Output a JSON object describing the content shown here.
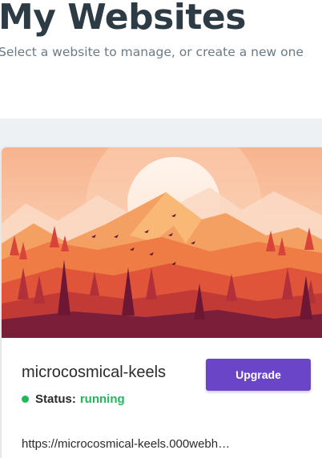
{
  "header": {
    "title": "My Websites",
    "subtitle": "Select a website to manage, or create a new one"
  },
  "website_card": {
    "name": "microcosmical-keels",
    "upgrade_label": "Upgrade",
    "status_label": "Status:",
    "status_value": "running",
    "url": "https://microcosmical-keels.000webh…"
  },
  "colors": {
    "title": "#2d3b45",
    "accent_button": "#6a45c8",
    "status_running": "#1fb85a",
    "panel_background": "#eef1f4"
  },
  "icons": {
    "hero": "mountain-landscape-illustration",
    "status": "status-dot-icon"
  }
}
